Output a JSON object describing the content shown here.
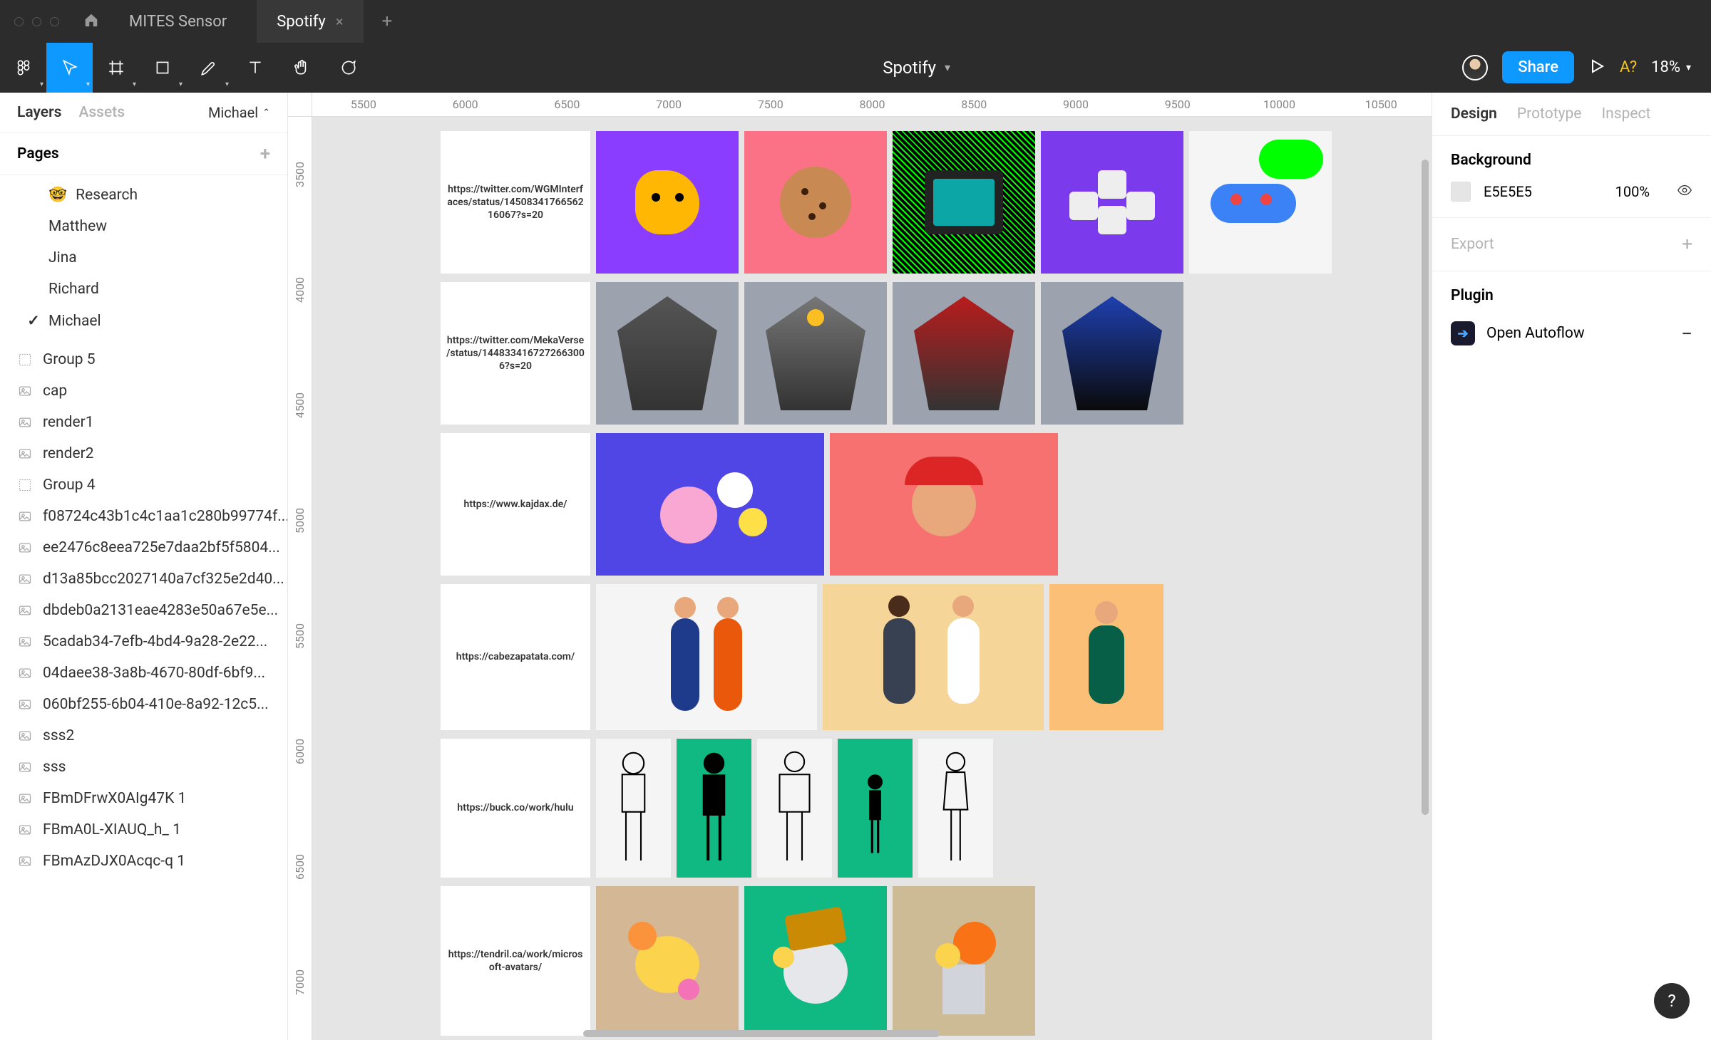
{
  "window": {
    "tabs": [
      {
        "label": "MITES Sensor",
        "active": false
      },
      {
        "label": "Spotify",
        "active": true
      }
    ]
  },
  "toolbar": {
    "file_title": "Spotify",
    "share_label": "Share",
    "missing_fonts": "A?",
    "zoom": "18%"
  },
  "left": {
    "tabs": {
      "layers": "Layers",
      "assets": "Assets"
    },
    "owner": "Michael",
    "pages_label": "Pages",
    "pages": [
      {
        "emoji": "🤓",
        "name": "Research"
      },
      {
        "emoji": "",
        "name": "Matthew"
      },
      {
        "emoji": "",
        "name": "Jina"
      },
      {
        "emoji": "",
        "name": "Richard"
      },
      {
        "emoji": "",
        "name": "Michael",
        "current": true
      }
    ],
    "layers": [
      {
        "icon": "group",
        "name": "Group 5"
      },
      {
        "icon": "image",
        "name": "cap"
      },
      {
        "icon": "image",
        "name": "render1"
      },
      {
        "icon": "image",
        "name": "render2"
      },
      {
        "icon": "group",
        "name": "Group 4"
      },
      {
        "icon": "image",
        "name": "f08724c43b1c4c1aa1c280b99774f..."
      },
      {
        "icon": "image",
        "name": "ee2476c8eea725e7daa2bf5f5804..."
      },
      {
        "icon": "image",
        "name": "d13a85bcc2027140a7cf325e2d40..."
      },
      {
        "icon": "image",
        "name": "dbdeb0a2131eae4283e50a67e5e..."
      },
      {
        "icon": "image",
        "name": "5cadab34-7efb-4bd4-9a28-2e22..."
      },
      {
        "icon": "image",
        "name": "04daee38-3a8b-4670-80df-6bf9..."
      },
      {
        "icon": "image",
        "name": "060bf255-6b04-410e-8a92-12c5..."
      },
      {
        "icon": "image",
        "name": "sss2"
      },
      {
        "icon": "image",
        "name": "sss"
      },
      {
        "icon": "text",
        "name": "FBmDFrwX0AIg47K 1"
      },
      {
        "icon": "text",
        "name": "FBmA0L-XIAUQ_h_ 1"
      },
      {
        "icon": "text",
        "name": "FBmAzDJX0Acqc-q 1"
      }
    ]
  },
  "ruler": {
    "h": [
      "5500",
      "6000",
      "6500",
      "7000",
      "7500",
      "8000",
      "8500",
      "9000",
      "9500",
      "10000",
      "10500"
    ],
    "v": [
      "3500",
      "4000",
      "4500",
      "5000",
      "5500",
      "6000",
      "6500",
      "7000"
    ]
  },
  "rows": [
    {
      "label": "https://twitter.com/WGMInterfaces/status/1450834176656216067?s=20"
    },
    {
      "label": "https://twitter.com/MekaVerse/status/1448334167272663006?s=20"
    },
    {
      "label": "https://www.kajdax.de/"
    },
    {
      "label": "https://cabezapatata.com/"
    },
    {
      "label": "https://buck.co/work/hulu"
    },
    {
      "label": "https://tendril.ca/work/microsoft-avatars/"
    }
  ],
  "right": {
    "tabs": {
      "design": "Design",
      "prototype": "Prototype",
      "inspect": "Inspect"
    },
    "background": {
      "title": "Background",
      "hex": "E5E5E5",
      "opacity": "100%"
    },
    "export": {
      "title": "Export"
    },
    "plugin": {
      "title": "Plugin",
      "name": "Open Autoflow"
    }
  },
  "help": "?"
}
